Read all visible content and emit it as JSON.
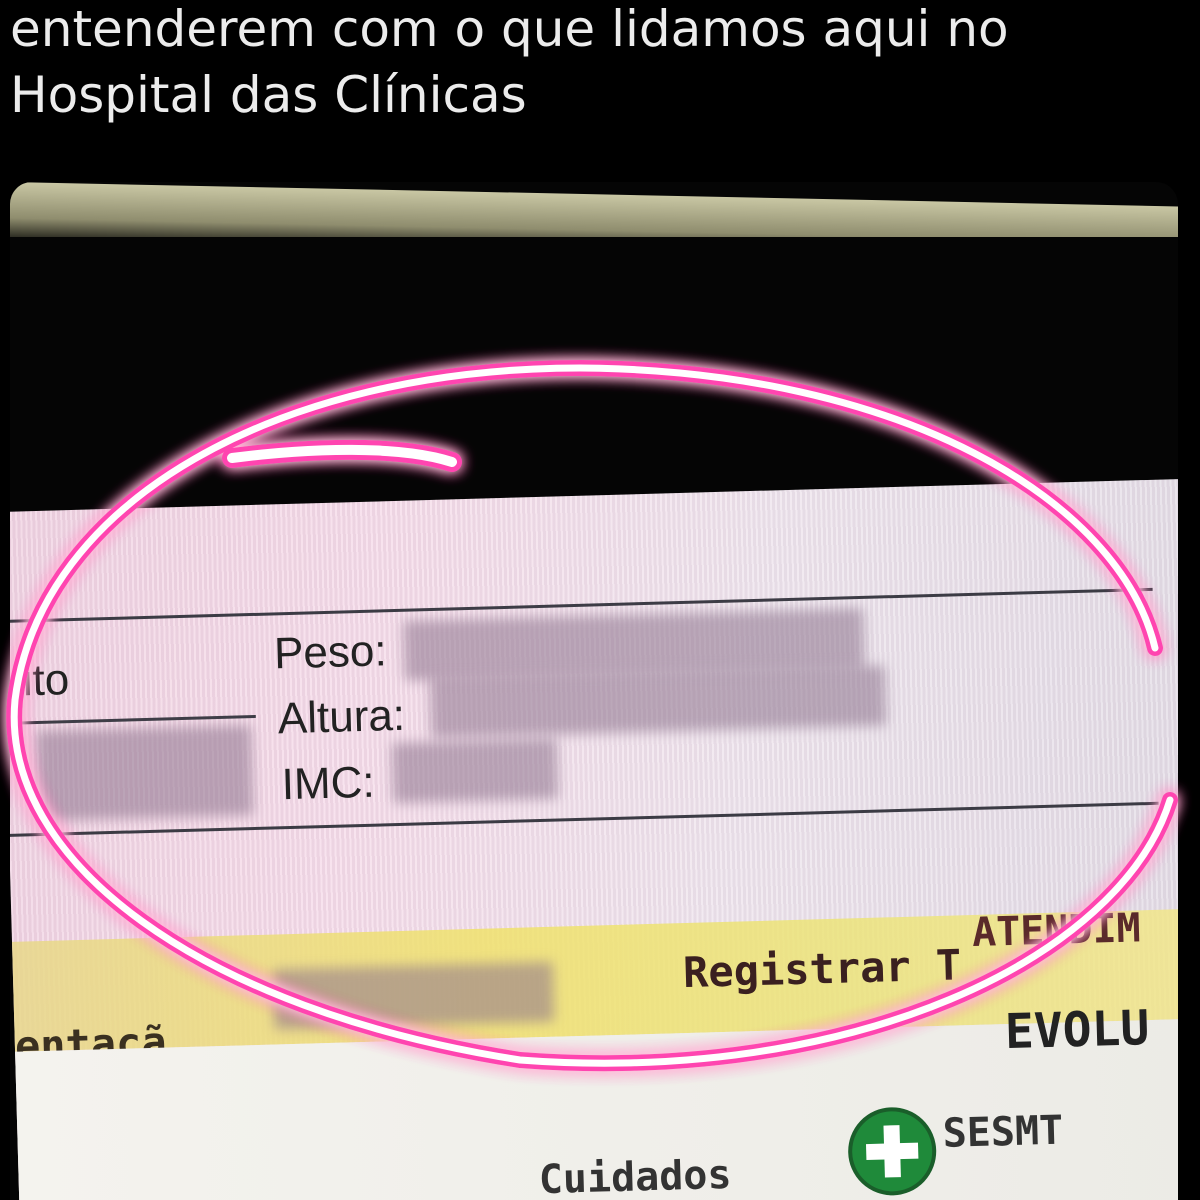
{
  "caption": {
    "line1": "entenderem com o que lidamos aqui no",
    "line2": "Hospital das Clínicas"
  },
  "form": {
    "partial_left_label": "ito",
    "weight_label": "Peso:",
    "height_label": "Altura:",
    "bmi_label": "IMC:"
  },
  "bottom_ui": {
    "left_partial": "entaçã",
    "register_button": "Registrar T",
    "register_suffix": "ATENDIM",
    "evolution_partial": "EVOLU",
    "care_label": "Cuidados",
    "sesmt_label": "SESMT"
  },
  "colors": {
    "annotation_circle": "#ff4fb4",
    "screen_tint": "#f4d6e6"
  }
}
